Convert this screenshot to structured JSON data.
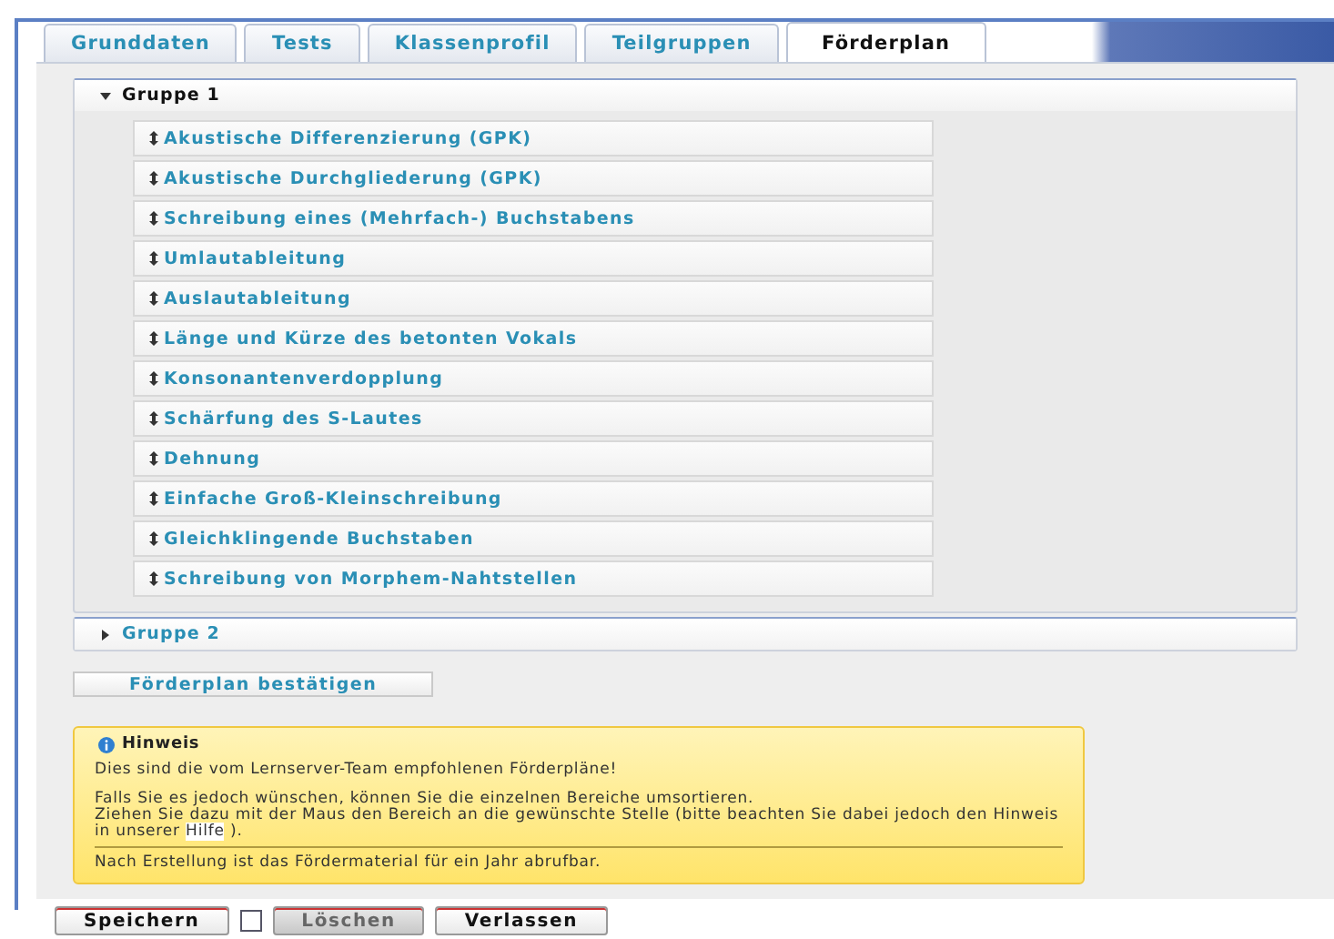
{
  "tabs": [
    {
      "label": "Grunddaten",
      "selected": false
    },
    {
      "label": "Tests",
      "selected": false
    },
    {
      "label": "Klassenprofil",
      "selected": false
    },
    {
      "label": "Teilgruppen",
      "selected": false
    },
    {
      "label": "Förderplan",
      "selected": true
    }
  ],
  "groups": [
    {
      "title": "Gruppe 1",
      "expanded": true,
      "items": [
        "Akustische Differenzierung (GPK)",
        "Akustische Durchgliederung (GPK)",
        "Schreibung eines (Mehrfach-) Buchstabens",
        "Umlautableitung",
        "Auslautableitung",
        "Länge und Kürze des betonten Vokals",
        "Konsonantenverdopplung",
        "Schärfung des S-Lautes",
        "Dehnung",
        "Einfache Groß-Kleinschreibung",
        "Gleichklingende Buchstaben",
        "Schreibung von Morphem-Nahtstellen"
      ]
    },
    {
      "title": "Gruppe 2",
      "expanded": false
    }
  ],
  "confirm_button": "Förderplan bestätigen",
  "hint": {
    "title": "Hinweis",
    "intro": "Dies sind die vom Lernserver-Team empfohlenen Förderpläne!",
    "line1": "Falls Sie es jedoch wünschen, können Sie die einzelnen Bereiche umsortieren.",
    "line2_before": "Ziehen Sie dazu mit der Maus den Bereich an die gewünschte Stelle (bitte beachten Sie dabei jedoch den Hinweis in unserer",
    "link": "Hilfe",
    "line2_after": ").",
    "footer": "Nach Erstellung ist das Fördermaterial für ein Jahr abrufbar."
  },
  "footer_buttons": [
    {
      "kind": "button",
      "label": "Speichern",
      "disabled": false
    },
    {
      "kind": "checkbox",
      "checked": false
    },
    {
      "kind": "button",
      "label": "Löschen",
      "disabled": true
    },
    {
      "kind": "button",
      "label": "Verlassen",
      "disabled": false
    }
  ]
}
